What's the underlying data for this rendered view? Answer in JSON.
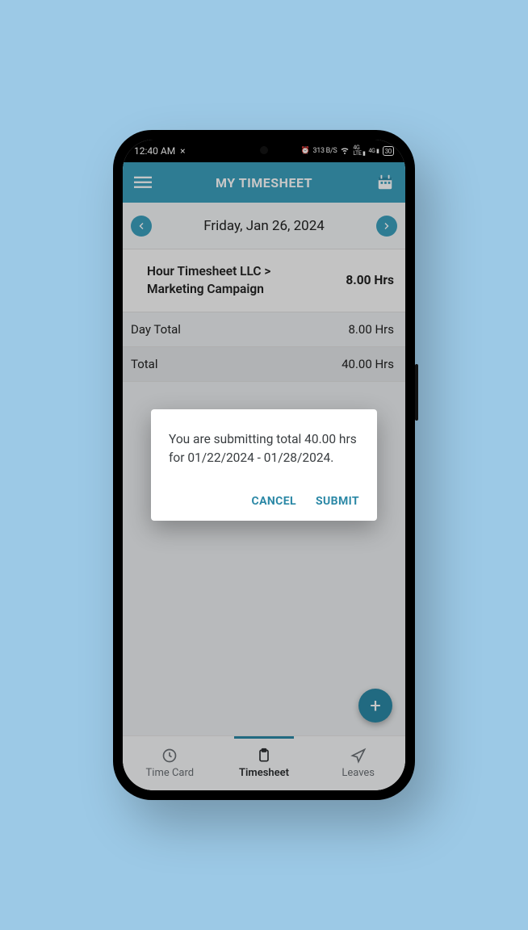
{
  "status": {
    "time": "12:40 AM",
    "close": "×",
    "alarm": "⏰",
    "net": "313 B/S",
    "wifi": "📶",
    "sig1": "4G LTE",
    "sig2": "4G",
    "battery": "30"
  },
  "header": {
    "title": "MY TIMESHEET"
  },
  "dateNav": {
    "label": "Friday, Jan 26, 2024"
  },
  "entry": {
    "name": "Hour Timesheet LLC > Marketing Campaign",
    "hours": "8.00 Hrs"
  },
  "dayTotal": {
    "label": "Day Total",
    "value": "8.00 Hrs"
  },
  "grandTotal": {
    "label": "Total",
    "value": "40.00 Hrs"
  },
  "fab": {
    "glyph": "+"
  },
  "tabs": {
    "timecard": "Time Card",
    "timesheet": "Timesheet",
    "leaves": "Leaves"
  },
  "dialog": {
    "message": "You are submitting total 40.00 hrs for 01/22/2024 - 01/28/2024.",
    "cancel": "CANCEL",
    "submit": "SUBMIT"
  }
}
